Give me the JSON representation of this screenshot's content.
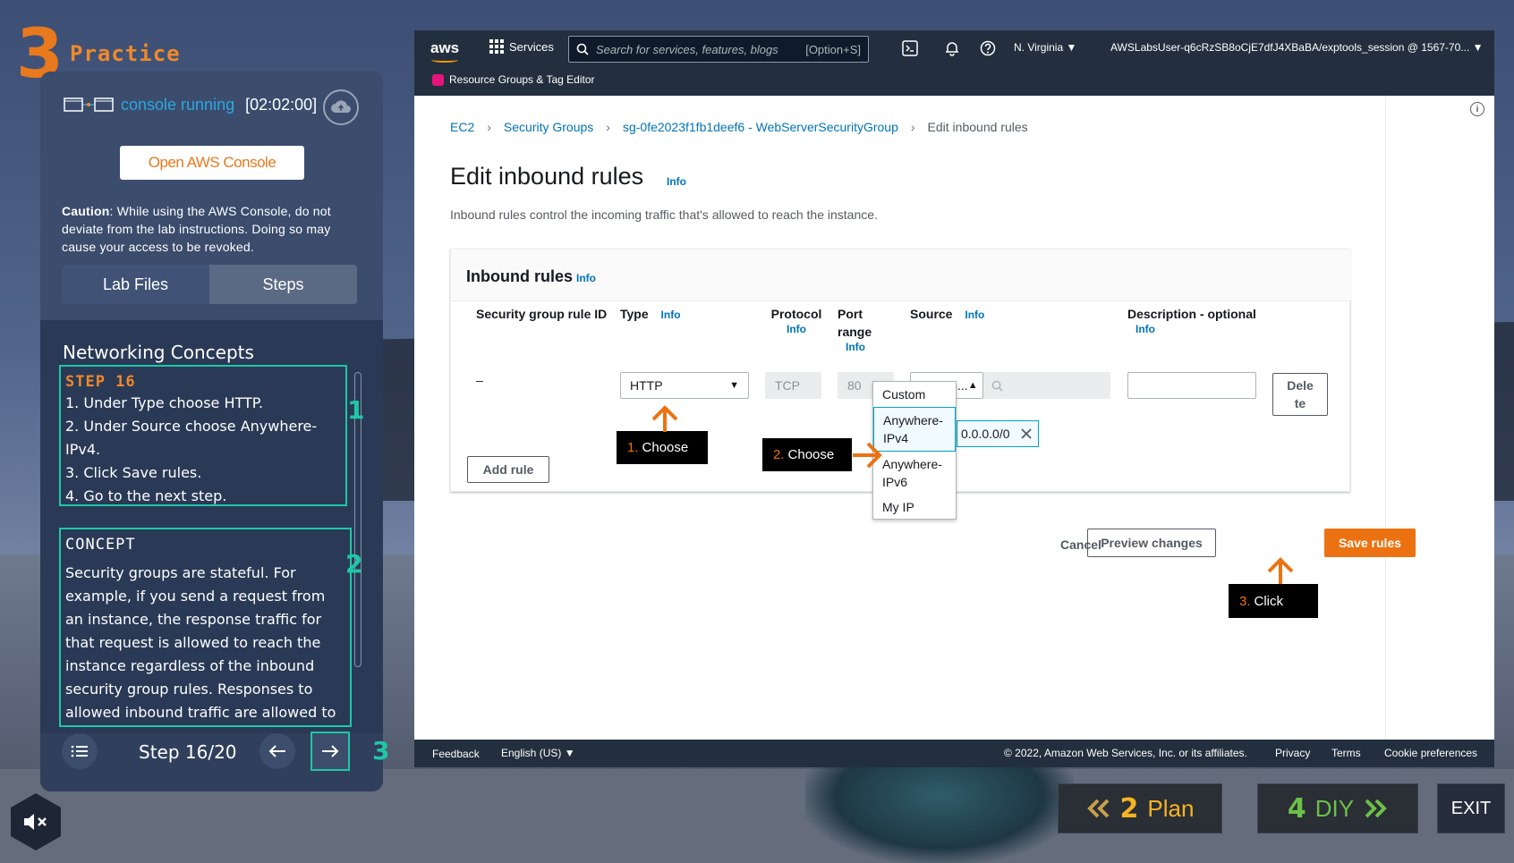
{
  "practice": {
    "number": "3",
    "label": "Practice"
  },
  "console": {
    "status": "console running",
    "timer": "[02:02:00]",
    "open_button": "Open AWS Console"
  },
  "caution": {
    "label": "Caution",
    "text": ": While using the AWS Console, do not deviate from the lab instructions. Doing so may cause your access to be revoked."
  },
  "tabs": {
    "lab_files": "Lab Files",
    "steps": "Steps"
  },
  "section_title": "Networking Concepts",
  "step": {
    "title": "STEP 16",
    "lines": [
      "1.  Under Type choose HTTP.",
      "2.  Under Source choose Anywhere-IPv4.",
      "3.  Click Save rules.",
      "4.  Go to the next step."
    ]
  },
  "concept": {
    "title": "CONCEPT",
    "text": "Security groups are stateful. For example, if you send a request from an instance, the response traffic for that request is allowed to reach the instance regardless of the inbound security group rules. Responses to allowed inbound traffic are allowed to leave the"
  },
  "markers": [
    "1",
    "2",
    "3"
  ],
  "step_counter": "Step 16/20",
  "aws": {
    "logo": "aws",
    "services": "Services",
    "search_placeholder": "Search for services, features, blogs",
    "search_hint": "[Option+S]",
    "region": "N. Virginia ▼",
    "account": "AWSLabsUser-q6cRzSB8oCjE7dfJ4XBaBA/exptools_session @ 1567-70... ▼",
    "resource_groups": "Resource Groups & Tag Editor"
  },
  "breadcrumb": [
    "EC2",
    "Security Groups",
    "sg-0fe2023f1fb1deef6 - WebServerSecurityGroup",
    "Edit inbound rules"
  ],
  "page": {
    "title": "Edit inbound rules",
    "info": "Info",
    "description": "Inbound rules control the incoming traffic that's allowed to reach the instance."
  },
  "card": {
    "title": "Inbound rules",
    "columns": {
      "rule_id": "Security group rule ID",
      "type": "Type",
      "protocol": "Protocol",
      "port": "Port range",
      "source": "Source",
      "description": "Description - optional"
    },
    "row": {
      "rule_id": "–",
      "type": "HTTP",
      "protocol": "TCP",
      "port": "80",
      "source": "Anywh...",
      "cidr": "0.0.0.0/0",
      "delete": "Delete"
    },
    "add_rule": "Add rule",
    "source_options": [
      "Custom",
      "Anywhere-IPv4",
      "Anywhere-IPv6",
      "My IP"
    ]
  },
  "actions": {
    "cancel": "Cancel",
    "preview": "Preview changes",
    "save": "Save rules"
  },
  "callouts": [
    {
      "num": "1.",
      "text": "Choose"
    },
    {
      "num": "2.",
      "text": "Choose"
    },
    {
      "num": "3.",
      "text": "Click"
    }
  ],
  "footer": {
    "feedback": "Feedback",
    "language": "English (US) ▼",
    "copyright": "© 2022, Amazon Web Services, Inc. or its affiliates.",
    "privacy": "Privacy",
    "terms": "Terms",
    "cookies": "Cookie preferences"
  },
  "bottom_nav": {
    "plan_num": "2",
    "plan_label": "Plan",
    "diy_num": "4",
    "diy_label": "DIY",
    "exit": "EXIT"
  },
  "colors": {
    "accent": "#ec7211",
    "teal": "#1fc7a6",
    "aws_nav": "#232f3e",
    "link": "#0073bb",
    "plan_green": "#8bc34a"
  }
}
